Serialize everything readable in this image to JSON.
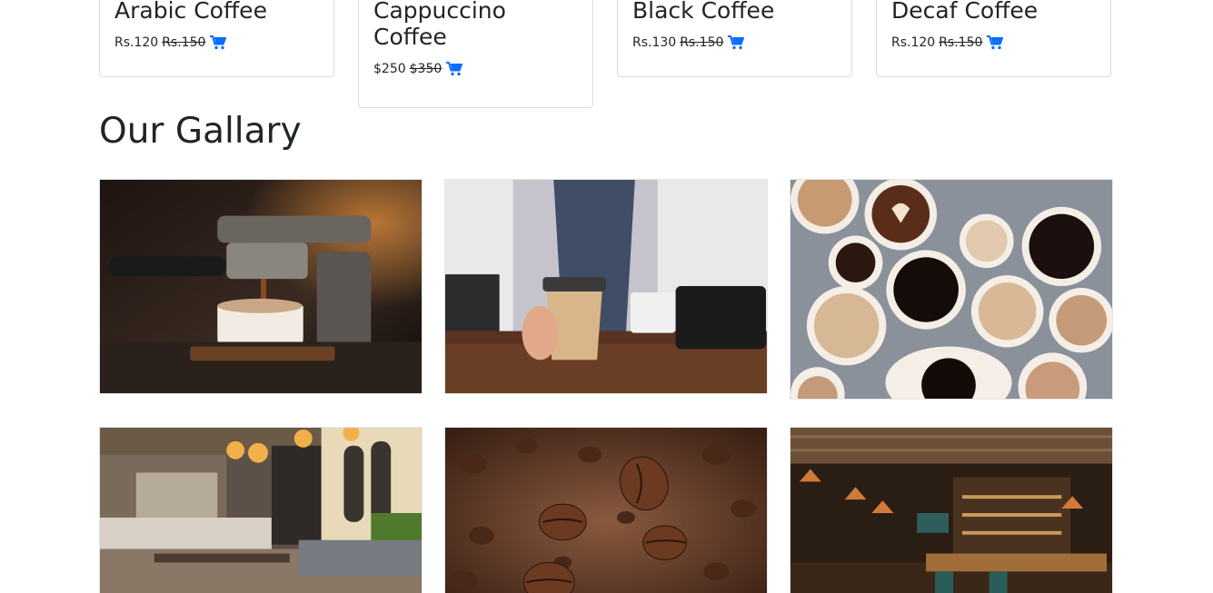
{
  "products": [
    {
      "name": "Arabic Coffee",
      "price": "Rs.120",
      "old_price": "Rs.150",
      "cart_icon": "shopping-cart-icon"
    },
    {
      "name": "Cappuccino Coffee",
      "price": "$250",
      "old_price": "$350",
      "cart_icon": "shopping-cart-icon"
    },
    {
      "name": "Black Coffee",
      "price": "Rs.130",
      "old_price": "Rs.150",
      "cart_icon": "shopping-cart-icon"
    },
    {
      "name": "Decaf Coffee",
      "price": "Rs.120",
      "old_price": "Rs.150",
      "cart_icon": "shopping-cart-icon"
    }
  ],
  "gallery": {
    "title": "Our Gallary",
    "images": [
      "espresso-machine-image",
      "barista-takeaway-cup-image",
      "coffee-cups-overhead-image",
      "cafe-interior-image",
      "coffee-beans-image",
      "bar-interior-image"
    ]
  },
  "colors": {
    "accent": "#0d6efd",
    "text": "#212529",
    "card_border": "#dcdcdc"
  }
}
